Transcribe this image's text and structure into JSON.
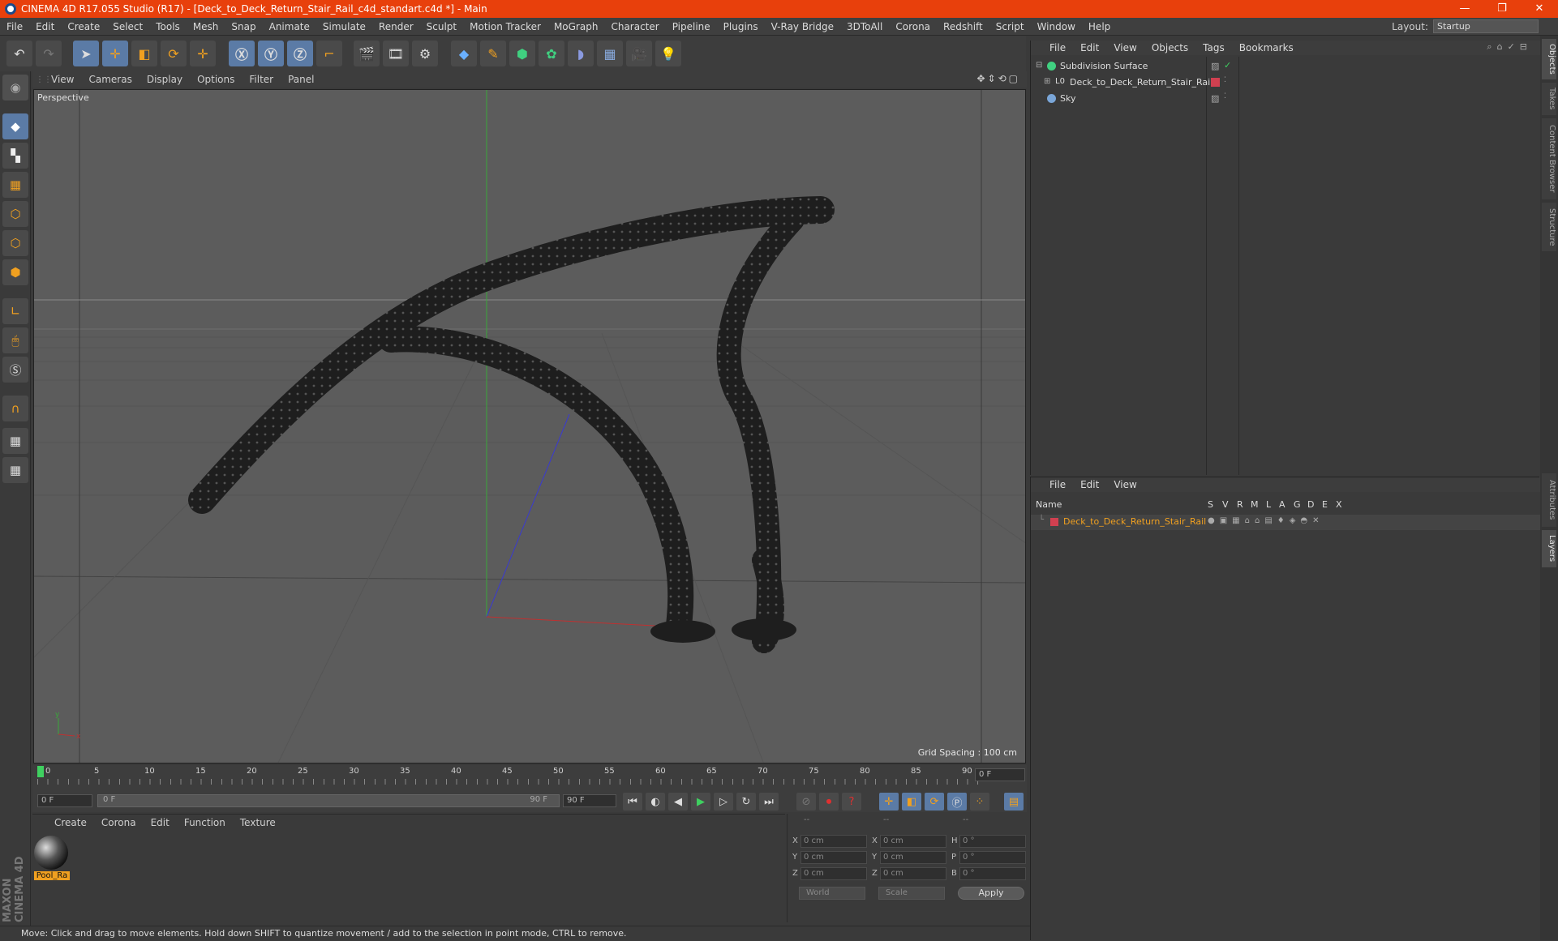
{
  "window": {
    "title": "CINEMA 4D R17.055 Studio (R17) - [Deck_to_Deck_Return_Stair_Rail_c4d_standart.c4d *] - Main",
    "minimize": "—",
    "restore": "❐",
    "close": "✕"
  },
  "menubar": {
    "items": [
      "File",
      "Edit",
      "Create",
      "Select",
      "Tools",
      "Mesh",
      "Snap",
      "Animate",
      "Simulate",
      "Render",
      "Sculpt",
      "Motion Tracker",
      "MoGraph",
      "Character",
      "Pipeline",
      "Plugins",
      "V-Ray Bridge",
      "3DToAll",
      "Corona",
      "Redshift",
      "Script",
      "Window",
      "Help"
    ],
    "layout_label": "Layout:",
    "layout_value": "Startup"
  },
  "viewport": {
    "menu": [
      "View",
      "Cameras",
      "Display",
      "Options",
      "Filter",
      "Panel"
    ],
    "label": "Perspective",
    "grid_spacing": "Grid Spacing : 100 cm"
  },
  "timeline": {
    "ticks": [
      "0",
      "5",
      "10",
      "15",
      "20",
      "25",
      "30",
      "35",
      "40",
      "45",
      "50",
      "55",
      "60",
      "65",
      "70",
      "75",
      "80",
      "85",
      "90"
    ],
    "current_frame_field": "0 F",
    "start_field": "0 F",
    "range_start": "0 F",
    "range_end": "90 F",
    "end_field": "90 F"
  },
  "materials": {
    "menu": [
      "Create",
      "Corona",
      "Edit",
      "Function",
      "Texture"
    ],
    "items": [
      {
        "name": "Pool_Ra"
      }
    ]
  },
  "coords": {
    "headers": [
      "--",
      "--",
      "--"
    ],
    "rows": [
      {
        "a_label": "X",
        "a_val": "0 cm",
        "b_label": "X",
        "b_val": "0 cm",
        "c_label": "H",
        "c_val": "0 °"
      },
      {
        "a_label": "Y",
        "a_val": "0 cm",
        "b_label": "Y",
        "b_val": "0 cm",
        "c_label": "P",
        "c_val": "0 °"
      },
      {
        "a_label": "Z",
        "a_val": "0 cm",
        "b_label": "Z",
        "b_val": "0 cm",
        "c_label": "B",
        "c_val": "0 °"
      }
    ],
    "mode1": "World",
    "mode2": "Scale",
    "apply": "Apply"
  },
  "status": "Move: Click and drag to move elements. Hold down SHIFT to quantize movement / add to the selection in point mode, CTRL to remove.",
  "objects": {
    "menu": [
      "File",
      "Edit",
      "View",
      "Objects",
      "Tags",
      "Bookmarks"
    ],
    "items": [
      {
        "name": "Subdivision Surface",
        "indent": 0
      },
      {
        "name": "Deck_to_Deck_Return_Stair_Rail",
        "indent": 1
      },
      {
        "name": "Sky",
        "indent": 0
      }
    ]
  },
  "layers": {
    "menu": [
      "File",
      "Edit",
      "View"
    ],
    "name_header": "Name",
    "columns": [
      "S",
      "V",
      "R",
      "M",
      "L",
      "A",
      "G",
      "D",
      "E",
      "X"
    ],
    "items": [
      {
        "name": "Deck_to_Deck_Return_Stair_Rail",
        "color": "#d04050"
      }
    ]
  },
  "right_tabs": [
    "Objects",
    "Takes",
    "Content Browser",
    "Structure",
    "Attributes",
    "Layers"
  ],
  "brand": "MAXON CINEMA 4D",
  "colors": {
    "accent": "#e8400c",
    "selected": "#5b7ba6",
    "layer_text": "#f0a020"
  }
}
